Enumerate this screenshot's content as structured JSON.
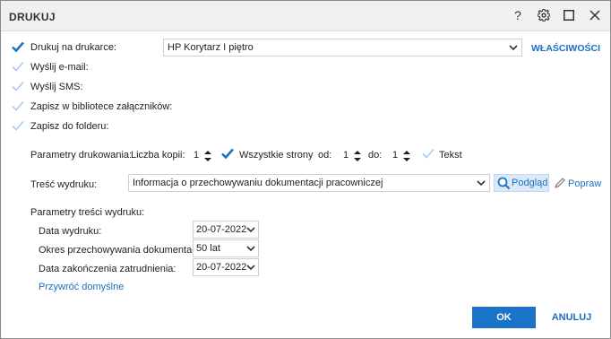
{
  "window": {
    "title": "DRUKUJ"
  },
  "titlebar": {
    "help_label": "?"
  },
  "options": {
    "print_label": "Drukuj na drukarce:",
    "email_label": "Wyślij e-mail:",
    "sms_label": "Wyślij SMS:",
    "attachments_label": "Zapisz w bibliotece załączników:",
    "folder_label": "Zapisz do folderu:"
  },
  "printer": {
    "value": "HP Korytarz I piętro",
    "properties_label": "WŁAŚCIWOŚCI"
  },
  "print_params": {
    "label": "Parametry drukowania:",
    "copies_label": "Liczba kopii:",
    "copies_value": "1",
    "all_pages_label": "Wszystkie strony",
    "from_label": "od:",
    "from_value": "1",
    "to_label": "do:",
    "to_value": "1",
    "text_label": "Tekst"
  },
  "content": {
    "label": "Treść wydruku:",
    "value": "Informacja o przechowywaniu dokumentacji pracowniczej",
    "preview_label": "Podgląd",
    "edit_label": "Popraw"
  },
  "content_params": {
    "heading": "Parametry treści wydruku:",
    "print_date_label": "Data wydruku:",
    "print_date_value": "20-07-2022",
    "retention_label": "Okres przechowywania dokumentacji:",
    "retention_value": "50 lat",
    "employment_end_label": "Data zakończenia zatrudnienia:",
    "employment_end_value": "20-07-2022",
    "restore_defaults_label": "Przywróć domyślne"
  },
  "footer": {
    "ok_label": "OK",
    "cancel_label": "ANULUJ"
  },
  "colors": {
    "accent": "#1b74c7",
    "check": "#1b74c7",
    "check_disabled": "#9cc3ea"
  }
}
